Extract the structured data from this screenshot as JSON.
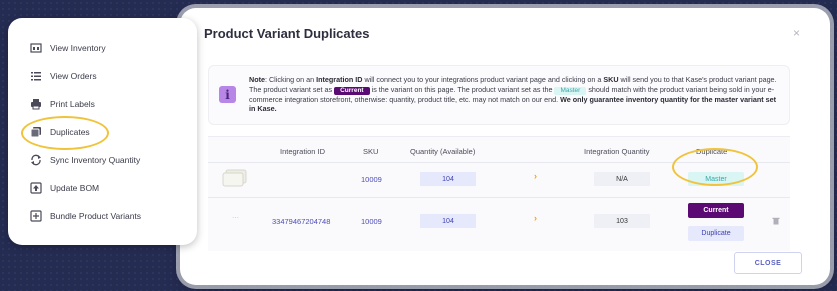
{
  "modal": {
    "title": "Product Variant Duplicates",
    "close_icon": "×",
    "note": {
      "label": "Note",
      "t1": ": Clicking on an ",
      "b1": "Integration ID",
      "t2": " will connect you to your integrations product variant page and clicking on a ",
      "b2": "SKU",
      "t3": " will send you to that Kase's product variant page. The product variant set as ",
      "current_pill": "Current",
      "t4": " is the variant on this page. The product variant set as the ",
      "master_pill": "Master",
      "t5": " should match with the product variant being sold in your e-commerce integration storefront, otherwise: quantity, product title, etc. may not match on our end. ",
      "b3": "We only guarantee inventory quantity for the master variant set in Kase."
    },
    "table": {
      "headers": {
        "integration_id": "Integration ID",
        "sku": "SKU",
        "quantity": "Quantity (Available)",
        "integration_quantity": "Integration Quantity",
        "duplicate": "Duplicate"
      },
      "rows": [
        {
          "integration_id": "",
          "sku": "10009",
          "quantity": "104",
          "arrow": "›",
          "integration_quantity": "N/A",
          "master_button": "Master"
        },
        {
          "integration_id": "33479467204748",
          "sku": "10009",
          "quantity": "104",
          "arrow": "›",
          "integration_quantity": "103",
          "current_button": "Current",
          "duplicate_button": "Duplicate"
        }
      ]
    },
    "close_button": "CLOSE"
  },
  "side_menu": {
    "items": [
      {
        "label": "View Inventory",
        "icon": "inventory-icon"
      },
      {
        "label": "View Orders",
        "icon": "list-icon"
      },
      {
        "label": "Print Labels",
        "icon": "printer-icon"
      },
      {
        "label": "Duplicates",
        "icon": "duplicates-icon"
      },
      {
        "label": "Sync Inventory Quantity",
        "icon": "sync-icon"
      },
      {
        "label": "Update BOM",
        "icon": "upload-icon"
      },
      {
        "label": "Bundle Product Variants",
        "icon": "bundle-icon"
      }
    ]
  },
  "colors": {
    "background": "#252c52",
    "accent_purple": "#5b0a73",
    "master_teal": "#d9f5f4",
    "highlight_yellow": "#f0c33a",
    "link_blue": "#4d4db8"
  }
}
